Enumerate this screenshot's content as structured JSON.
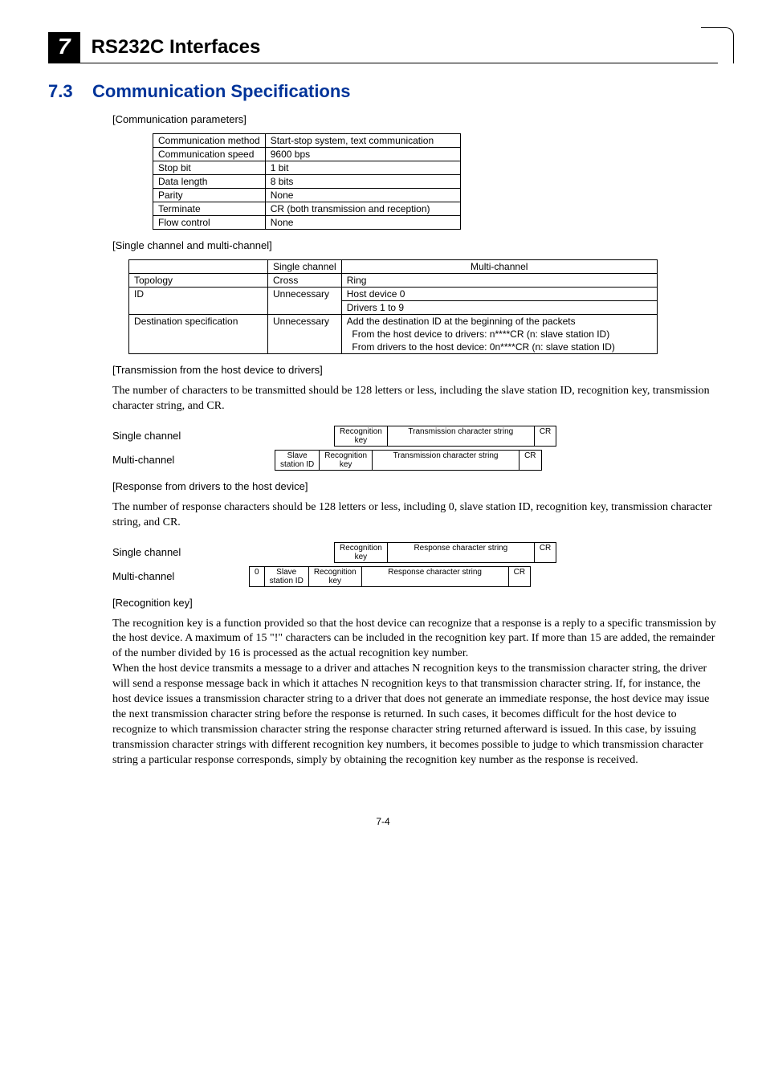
{
  "chapter": {
    "number": "7",
    "title": "RS232C Interfaces"
  },
  "section": {
    "number": "7.3",
    "title": "Communication Specifications"
  },
  "headings": {
    "comm_params": "[Communication parameters]",
    "single_multi": "[Single channel and multi-channel]",
    "trans_h2d": "[Transmission from the host device to drivers]",
    "resp_d2h": "[Response from drivers to the host device]",
    "recog_key": "[Recognition key]"
  },
  "comm_table": {
    "rows": [
      {
        "k": "Communication method",
        "v": "Start-stop system, text communication"
      },
      {
        "k": "Communication speed",
        "v": "9600 bps"
      },
      {
        "k": "Stop bit",
        "v": "1 bit"
      },
      {
        "k": "Data length",
        "v": "8 bits"
      },
      {
        "k": "Parity",
        "v": "None"
      },
      {
        "k": "Terminate",
        "v": "CR (both transmission and reception)"
      },
      {
        "k": "Flow control",
        "v": "None"
      }
    ]
  },
  "chan_table": {
    "head": {
      "c1": "",
      "c2": "Single channel",
      "c3": "Multi-channel"
    },
    "r1": {
      "c1": "Topology",
      "c2": "Cross",
      "c3": "Ring"
    },
    "r2": {
      "c1": "ID",
      "c2": "Unnecessary",
      "c3a": "Host device 0",
      "c3b": "Drivers 1 to 9"
    },
    "r3": {
      "c1": "Destination specification",
      "c2": "Unnecessary",
      "c3a": "Add the destination ID at the beginning of the packets",
      "c3b": "  From the host device to drivers: n****CR (n: slave station ID)",
      "c3c": "  From drivers to the host device: 0n****CR (n: slave station ID)"
    }
  },
  "para_trans": "The number of characters to be transmitted should be 128 letters or less, including the slave station ID, recognition key, transmission character string, and CR.",
  "para_resp": "The number of response characters should be 128 letters or less, including 0, slave station ID, recognition key, transmission character string, and CR.",
  "para_recog": "The recognition key is a function provided so that the host device can recognize that a response is a reply to a specific transmission by the host device. A maximum of 15 \"!\" characters can be included in the recognition key part. If more than 15 are added, the remainder of the number divided by 16 is processed as the actual recognition key number.\nWhen the host device transmits a message to a driver and attaches N recognition keys to the transmission character string, the driver will send a response message back in which it attaches N recognition keys to that transmission character string. If, for instance, the host device issues a transmission character string to a driver that does not generate an immediate response, the host device may issue the next transmission character string before the response is returned. In such cases, it becomes difficult for the host device to recognize to which transmission character string the response character string returned afterward is issued. In this case, by issuing transmission character strings with different recognition key numbers, it becomes possible to judge to which transmission character string a particular response corresponds, simply by obtaining the recognition key number as the response is received.",
  "packets": {
    "single_label": "Single channel",
    "multi_label": "Multi-channel",
    "zero": "0",
    "slave_top": "Slave",
    "slave_bot": "station ID",
    "recog_top": "Recognition",
    "recog_bot": "key",
    "tx_chars": "Transmission character string",
    "rx_chars": "Response character string",
    "cr": "CR"
  },
  "pagenum": "7-4"
}
